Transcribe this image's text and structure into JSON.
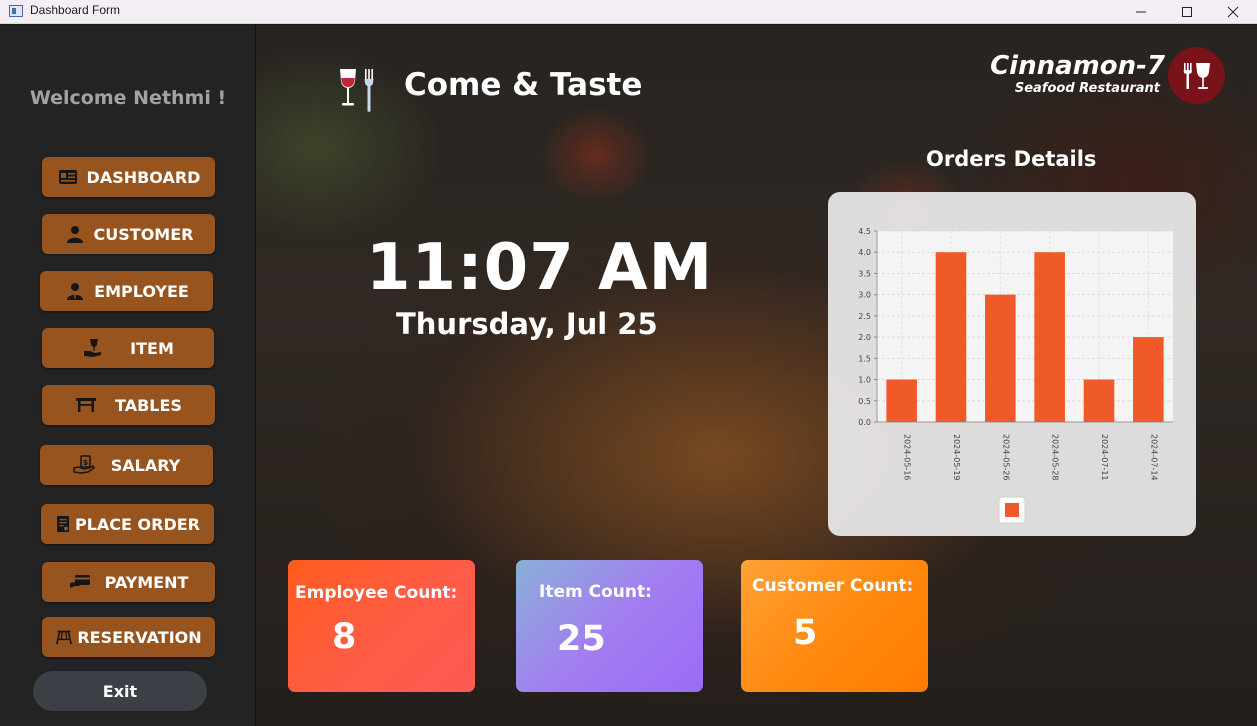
{
  "window": {
    "title": "Dashboard Form"
  },
  "sidebar": {
    "welcome": "Welcome Nethmi !",
    "items": [
      {
        "label": "DASHBOARD",
        "icon": "id-card-icon"
      },
      {
        "label": "CUSTOMER",
        "icon": "user-icon"
      },
      {
        "label": "EMPLOYEE",
        "icon": "user-tie-icon"
      },
      {
        "label": "ITEM",
        "icon": "wine-glass-hand-icon"
      },
      {
        "label": "TABLES",
        "icon": "table-icon"
      },
      {
        "label": "SALARY",
        "icon": "hand-money-icon"
      },
      {
        "label": "PLACE ORDER",
        "icon": "order-form-icon"
      },
      {
        "label": "PAYMENT",
        "icon": "card-payment-icon"
      },
      {
        "label": "RESERVATION",
        "icon": "reservation-table-icon"
      }
    ],
    "exit_label": "Exit"
  },
  "header": {
    "brand": "Come & Taste",
    "logo_name": "Cinnamon-7",
    "logo_sub": "Seafood Restaurant"
  },
  "clock": {
    "time": "11:07 AM",
    "date": "Thursday, Jul 25"
  },
  "orders": {
    "title": "Orders Details"
  },
  "stats": {
    "employee": {
      "label": "Employee Count:",
      "value": "8"
    },
    "item": {
      "label": "Item Count:",
      "value": "25"
    },
    "customer": {
      "label": "Customer Count:",
      "value": "5"
    }
  },
  "colors": {
    "accent": "#97541f",
    "bar": "#f05a28",
    "sidebar": "#232324"
  },
  "chart_data": {
    "type": "bar",
    "title": "",
    "xlabel": "",
    "ylabel": "",
    "categories": [
      "2024-05-16",
      "2024-05-19",
      "2024-05-26",
      "2024-05-28",
      "2024-07-11",
      "2024-07-14"
    ],
    "values": [
      1.0,
      4.0,
      3.0,
      4.0,
      1.0,
      2.0
    ],
    "y_ticks": [
      "0.0",
      "0.5",
      "1.0",
      "1.5",
      "2.0",
      "2.5",
      "3.0",
      "3.5",
      "4.0",
      "4.5"
    ],
    "ylim": [
      0,
      4.5
    ],
    "grid": true,
    "legend": "bottom-center",
    "bar_color": "#f05a28"
  }
}
